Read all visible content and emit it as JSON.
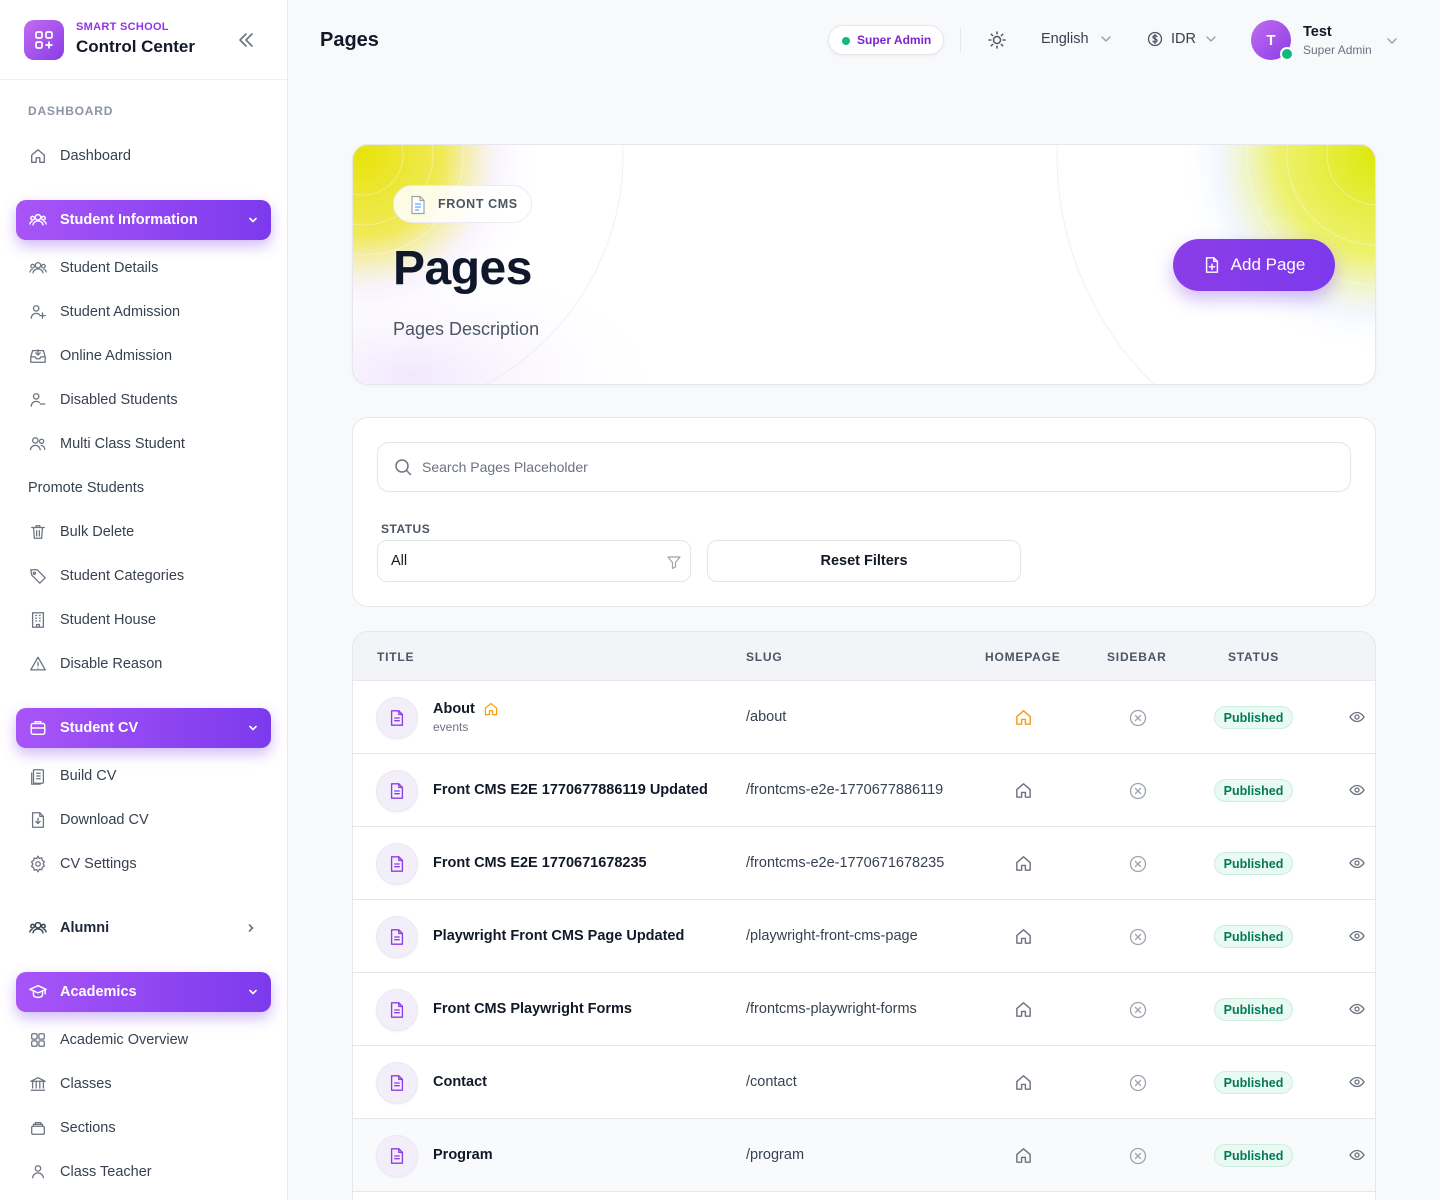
{
  "brand": {
    "small": "SMART SCHOOL",
    "title": "Control Center"
  },
  "colors": {
    "accent": "#7c3aed",
    "accent_light": "#a855f7",
    "success": "#10b981",
    "hero_glow": "#e8e30a"
  },
  "sidebar": {
    "section": "DASHBOARD",
    "dashboard": "Dashboard",
    "student_information": {
      "label": "Student Information",
      "items": [
        "Student Details",
        "Student Admission",
        "Online Admission",
        "Disabled Students",
        "Multi Class Student",
        "Promote Students",
        "Bulk Delete",
        "Student Categories",
        "Student House",
        "Disable Reason"
      ]
    },
    "student_cv": {
      "label": "Student CV",
      "items": [
        "Build CV",
        "Download CV",
        "CV Settings"
      ]
    },
    "alumni": "Alumni",
    "academics": {
      "label": "Academics",
      "items": [
        "Academic Overview",
        "Classes",
        "Sections",
        "Class Teacher"
      ]
    }
  },
  "header": {
    "title": "Pages",
    "role": "Super Admin",
    "language": "English",
    "currency": "IDR",
    "user_initial": "T",
    "user_name": "Test",
    "user_role": "Super Admin"
  },
  "hero": {
    "badge": "FRONT CMS",
    "title": "Pages",
    "description": "Pages Description",
    "add_button": "Add Page"
  },
  "filters": {
    "search_placeholder": "Search Pages Placeholder",
    "status_label": "STATUS",
    "status_value": "All",
    "reset_button": "Reset Filters"
  },
  "table": {
    "columns": [
      "TITLE",
      "SLUG",
      "HOMEPAGE",
      "SIDEBAR",
      "STATUS"
    ],
    "rows": [
      {
        "title": "About",
        "subtitle": "events",
        "slug": "/about",
        "homepage": true,
        "sidebar": false,
        "status": "Published"
      },
      {
        "title": "Front CMS E2E 1770677886119 Updated",
        "subtitle": "",
        "slug": "/frontcms-e2e-1770677886119",
        "homepage": false,
        "sidebar": false,
        "status": "Published"
      },
      {
        "title": "Front CMS E2E 1770671678235",
        "subtitle": "",
        "slug": "/frontcms-e2e-1770671678235",
        "homepage": false,
        "sidebar": false,
        "status": "Published"
      },
      {
        "title": "Playwright Front CMS Page Updated",
        "subtitle": "",
        "slug": "/playwright-front-cms-page",
        "homepage": false,
        "sidebar": false,
        "status": "Published"
      },
      {
        "title": "Front CMS Playwright Forms",
        "subtitle": "",
        "slug": "/frontcms-playwright-forms",
        "homepage": false,
        "sidebar": false,
        "status": "Published"
      },
      {
        "title": "Contact",
        "subtitle": "",
        "slug": "/contact",
        "homepage": false,
        "sidebar": false,
        "status": "Published"
      },
      {
        "title": "Program",
        "subtitle": "",
        "slug": "/program",
        "homepage": false,
        "sidebar": false,
        "status": "Published"
      }
    ]
  }
}
